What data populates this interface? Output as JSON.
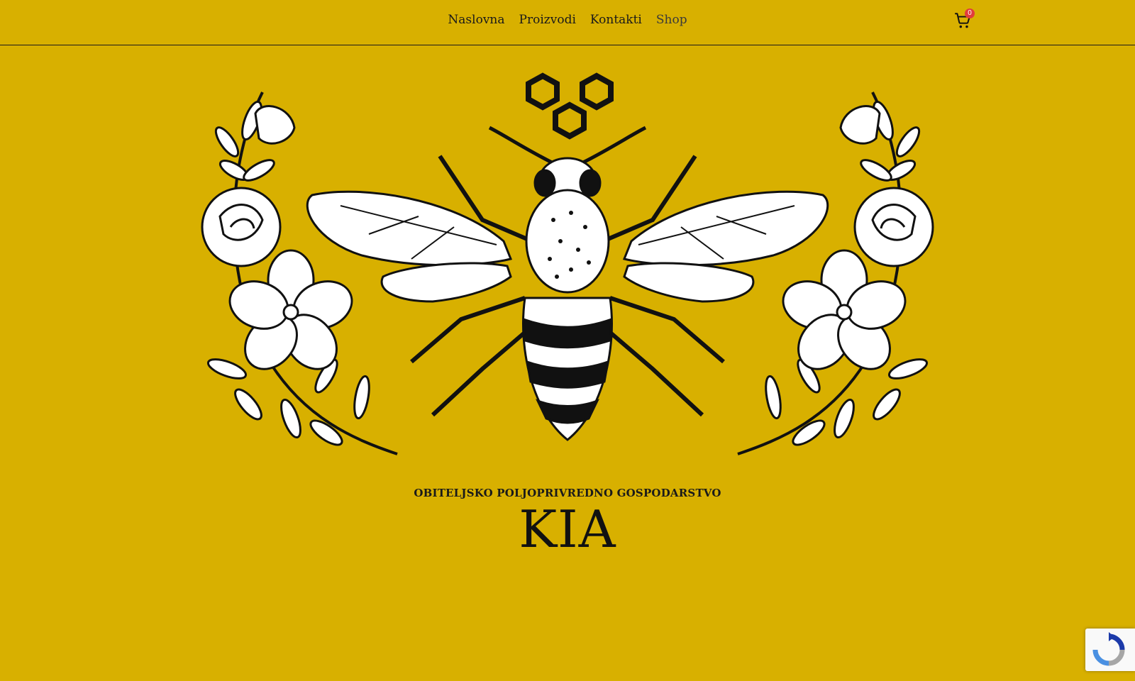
{
  "nav": {
    "items": [
      {
        "label": "Naslovna"
      },
      {
        "label": "Proizvodi"
      },
      {
        "label": "Kontakti"
      },
      {
        "label": "Shop"
      }
    ],
    "cart_count": "0",
    "cart_icon": "cart-icon"
  },
  "hero": {
    "subtitle": "OBITELJSKO POLJOPRIVREDNO GOSPODARSTVO",
    "brand": "KIA",
    "graphic": "bee-with-floral-wreath-illustration"
  },
  "recaptcha": {
    "icon": "recaptcha-icon"
  },
  "colors": {
    "background": "#d8b000",
    "ink": "#111111",
    "badge": "#e13c3c"
  }
}
